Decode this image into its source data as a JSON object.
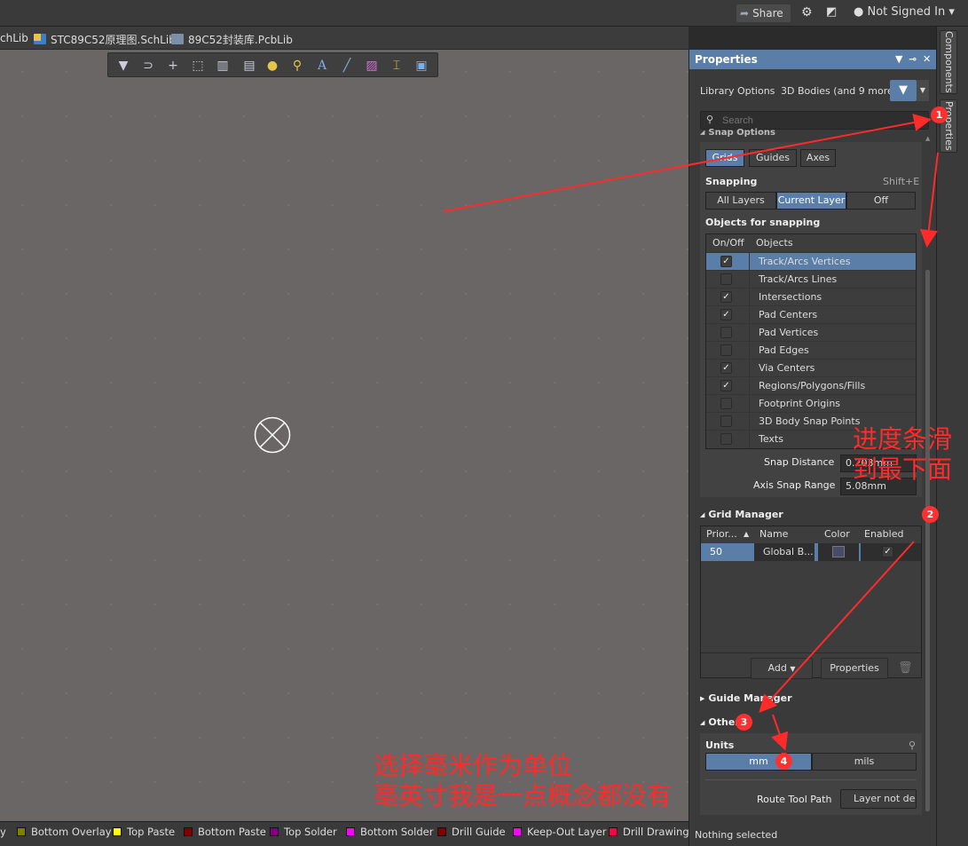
{
  "topbar": {
    "share_label": "Share",
    "user_label": "Not Signed In ▾",
    "icons": [
      "share-icon",
      "gear-icon",
      "visibility-icon",
      "user-icon"
    ]
  },
  "tabs": [
    {
      "label": "chLib"
    },
    {
      "label": "STC89C52原理图.SchLib"
    },
    {
      "label": "89C52封装库.PcbLib"
    }
  ],
  "canvas_toolbar": {
    "icons": [
      "filter-icon",
      "snap-magnet-icon",
      "cross-icon",
      "select-rect-icon",
      "chart-icon",
      "component-icon",
      "pad-icon",
      "via-icon",
      "text-icon",
      "line-icon",
      "route-icon",
      "dimension-icon",
      "region-icon"
    ]
  },
  "layers": [
    {
      "label": "y",
      "color": ""
    },
    {
      "label": "Bottom Overlay",
      "color": "#808000"
    },
    {
      "label": "Top Paste",
      "color": "#ffff00"
    },
    {
      "label": "Bottom Paste",
      "color": "#800000"
    },
    {
      "label": "Top Solder",
      "color": "#800080"
    },
    {
      "label": "Bottom Solder",
      "color": "#ff00ff"
    },
    {
      "label": "Drill Guide",
      "color": "#800000"
    },
    {
      "label": "Keep-Out Layer",
      "color": "#ff00ff"
    },
    {
      "label": "Drill Drawing",
      "color": "#ff0040"
    }
  ],
  "properties": {
    "title": "Properties",
    "library_options": "Library Options",
    "filter_summary": "3D Bodies (and 9 more)",
    "search_placeholder": "Search",
    "snap_section": "Snap Options",
    "snap_tabs": [
      "Grids",
      "Guides",
      "Axes"
    ],
    "snapping_label": "Snapping",
    "snapping_shortcut": "Shift+E",
    "snapping_modes": [
      "All Layers",
      "Current Layer",
      "Off"
    ],
    "objects_label": "Objects for snapping",
    "objects_header": [
      "On/Off",
      "Objects"
    ],
    "objects": [
      {
        "name": "Track/Arcs Vertices",
        "checked": true,
        "selected": true
      },
      {
        "name": "Track/Arcs Lines",
        "checked": false
      },
      {
        "name": "Intersections",
        "checked": true
      },
      {
        "name": "Pad Centers",
        "checked": true
      },
      {
        "name": "Pad Vertices",
        "checked": false
      },
      {
        "name": "Pad Edges",
        "checked": false
      },
      {
        "name": "Via Centers",
        "checked": true
      },
      {
        "name": "Regions/Polygons/Fills",
        "checked": true
      },
      {
        "name": "Footprint Origins",
        "checked": false
      },
      {
        "name": "3D Body Snap Points",
        "checked": false
      },
      {
        "name": "Texts",
        "checked": false
      }
    ],
    "snap_distance_label": "Snap Distance",
    "snap_distance_value": "0.203mm",
    "axis_snap_label": "Axis Snap Range",
    "axis_snap_value": "5.08mm",
    "grid_manager": "Grid Manager",
    "grid_header": [
      "Prior...",
      "Name",
      "Color",
      "Enabled"
    ],
    "grid_row": {
      "priority": "50",
      "name": "Global B...",
      "color": "#4a4a6a",
      "enabled": true
    },
    "add_label": "Add",
    "properties_label": "Properties",
    "guide_manager": "Guide Manager",
    "other": "Other",
    "units_label": "Units",
    "units": [
      "mm",
      "mils"
    ],
    "route_tool_label": "Route Tool Path",
    "route_tool_value": "Layer not de",
    "status": "Nothing selected"
  },
  "right_tabs": [
    "Components",
    "Properties"
  ],
  "annotations": {
    "note_scroll": [
      "进度条滑",
      "到最下面"
    ],
    "note_units": [
      "选择毫米作为单位",
      "毫英寸我是一点概念都没有"
    ],
    "badges": [
      "1",
      "2",
      "3",
      "4"
    ]
  }
}
